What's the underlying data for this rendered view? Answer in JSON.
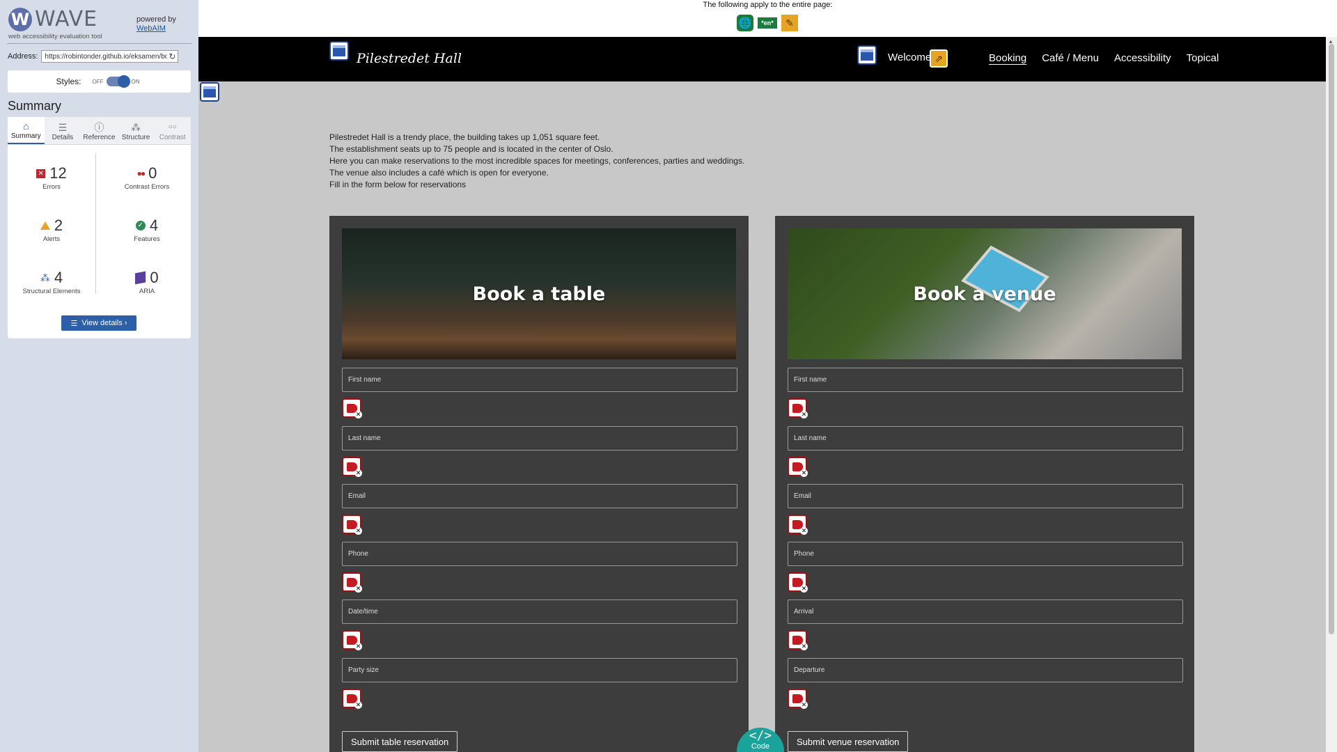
{
  "wave": {
    "logo_text": "WAVE",
    "tagline": "web accessibility evaluation tool",
    "powered_by": "powered by",
    "powered_link": "WebAIM",
    "address_label": "Address:",
    "address_value": "https://robintonder.github.io/eksamen/book",
    "styles_label": "Styles:",
    "styles_off": "OFF",
    "styles_on": "ON",
    "summary_title": "Summary",
    "tabs": [
      {
        "label": "Summary",
        "icon": "home-icon",
        "glyph": "⌂"
      },
      {
        "label": "Details",
        "icon": "list-icon",
        "glyph": "☰"
      },
      {
        "label": "Reference",
        "icon": "info-icon",
        "glyph": "ⓘ"
      },
      {
        "label": "Structure",
        "icon": "structure-icon",
        "glyph": "⁂"
      },
      {
        "label": "Contrast",
        "icon": "contrast-icon",
        "glyph": "○○"
      }
    ],
    "stats": {
      "errors": {
        "value": "12",
        "label": "Errors"
      },
      "contrast_errors": {
        "value": "0",
        "label": "Contrast Errors"
      },
      "alerts": {
        "value": "2",
        "label": "Alerts"
      },
      "features": {
        "value": "4",
        "label": "Features"
      },
      "structural": {
        "value": "4",
        "label": "Structural Elements"
      },
      "aria": {
        "value": "0",
        "label": "ARIA"
      }
    },
    "view_details": "View details ›"
  },
  "notice": {
    "text": "The following apply to the entire page:",
    "lang_badge": "*en*"
  },
  "site": {
    "brand": "Pilestredet Hall",
    "nav": {
      "welcome": "Welcome",
      "links": [
        "Booking",
        "Café / Menu",
        "Accessibility",
        "Topical"
      ]
    },
    "intro": [
      "Pilestredet Hall is a trendy place, the building takes up 1,051 square feet.",
      "The establishment seats up to 75 people and is located in the center of Oslo.",
      "Here you can make reservations to the most incredible spaces for meetings, conferences, parties and weddings.",
      "The venue also includes a café which is open for everyone.",
      "Fill in the form below for reservations"
    ],
    "table_card": {
      "title": "Book a table",
      "fields": [
        "First name",
        "Last name",
        "Email",
        "Phone",
        "Date/time",
        "Party size"
      ],
      "submit": "Submit table reservation"
    },
    "venue_card": {
      "title": "Book a venue",
      "fields": [
        "First name",
        "Last name",
        "Email",
        "Phone",
        "Arrival",
        "Departure"
      ],
      "submit": "Submit venue reservation"
    }
  },
  "code_tab": {
    "glyph": "</>",
    "label": "Code"
  },
  "colors": {
    "wave_blue": "#2d5fa8",
    "error_red": "#c0262d",
    "alert_orange": "#e6a324",
    "feature_green": "#2e8b57",
    "code_teal": "#1aa39a"
  }
}
